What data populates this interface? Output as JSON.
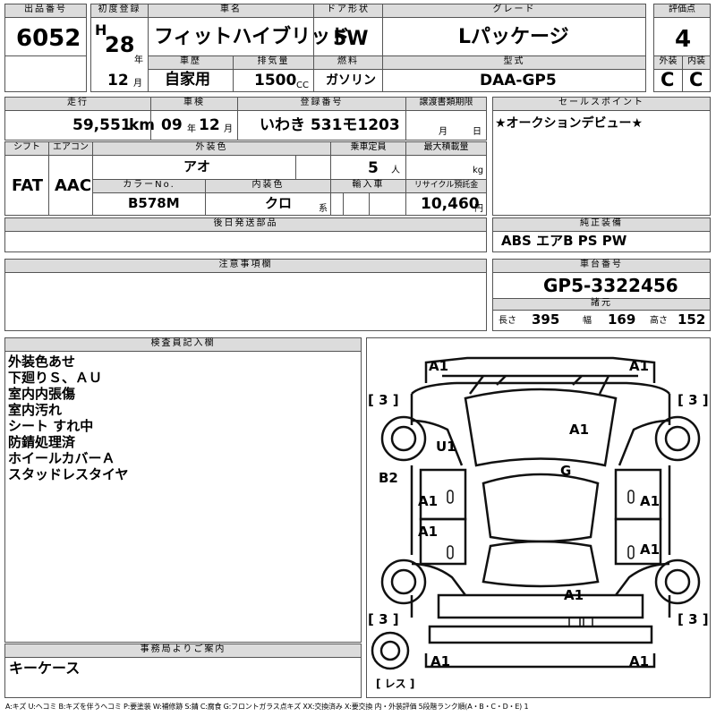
{
  "header": {
    "lot_label": "出品番号",
    "lot": "6052",
    "first_reg_label": "初度登録",
    "era": "H",
    "year": "28",
    "year_unit": "年",
    "month": "12",
    "month_unit": "月",
    "car_name_label": "車名",
    "car_name": "フィットハイブリッド",
    "history_label": "車歴",
    "history": "自家用",
    "displacement_label": "排気量",
    "displacement": "1500",
    "displacement_unit": "CC",
    "door_label": "ドア形状",
    "door": "5W",
    "fuel_label": "燃料",
    "fuel": "ガソリン",
    "grade_label": "グレード",
    "grade": "Lパッケージ",
    "model_label": "型式",
    "model": "DAA-GP5",
    "score_label": "評価点",
    "score": "4",
    "exterior_label": "外装",
    "exterior": "C",
    "interior_label": "内装",
    "interior": "C"
  },
  "row2": {
    "mileage_label": "走行",
    "mileage": "59,551",
    "mileage_unit": "km",
    "inspection_label": "車検",
    "insp_year": "09",
    "insp_year_unit": "年",
    "insp_month": "12",
    "insp_month_unit": "月",
    "reg_label": "登録番号",
    "reg": "いわき 531モ1203",
    "transfer_label": "譲渡書類期限",
    "transfer_month_unit": "月",
    "transfer_day_unit": "日",
    "shift_label": "シフト",
    "shift": "FAT",
    "ac_label": "エアコン",
    "ac": "AAC",
    "color_label": "外装色",
    "color": "アオ",
    "capacity_label": "乗車定員",
    "capacity": "5",
    "capacity_unit": "人",
    "load_label": "最大積載量",
    "load_unit": "kg",
    "color_no_label": "カラーNo.",
    "color_no": "B578M",
    "int_color_label": "内装色",
    "int_color": "クロ",
    "int_color_unit": "系",
    "import_label": "輸入車",
    "recycle_label": "リサイクル預託金",
    "recycle": "10,460",
    "recycle_unit": "円",
    "selling_label": "セールスポイント",
    "selling": "★オークションデビュー★"
  },
  "parts": {
    "label": "後日発送部品",
    "equip_label": "純正装備",
    "equip": "ABS エアB PS PW"
  },
  "notes": {
    "label": "注意事項欄"
  },
  "chassis": {
    "label": "車台番号",
    "number": "GP5-3322456",
    "spec_label": "諸元",
    "length_label": "長さ",
    "length": "395",
    "width_label": "幅",
    "width": "169",
    "height_label": "高さ",
    "height": "152"
  },
  "inspector": {
    "label": "検査員記入欄",
    "lines": [
      "外装色あせ",
      "下廻りＳ、ＡＵ",
      "室内内張傷",
      "室内汚れ",
      "シート すれ中",
      "防錆処理済",
      "ホイールカバーＡ",
      "スタッドレスタイヤ"
    ]
  },
  "office": {
    "label": "事務局よりご案内",
    "text": "キーケース"
  },
  "damage": {
    "a1_fl": "A1",
    "a1_fr": "A1",
    "tread_fl": "[ 3 ]",
    "tread_fr": "[ 3 ]",
    "u1": "U1",
    "hood": "A1",
    "roof": "G",
    "b2": "B2",
    "a1_ld": "A1",
    "a1_rd": "A1",
    "a1_lr": "A1",
    "a1_rr": "A1",
    "trunk": "A1",
    "tread_rl": "[ 3 ]",
    "tread_rr": "[ 3 ]",
    "a1_bl": "A1",
    "a1_br": "A1",
    "spare": "[ レス ]"
  },
  "legend": "A:キズ U:ヘコミ B:キズを伴うヘコミ P:要塗装 W:補修跡 S:錆 C:腐食 G:フロントガラス点キズ XX:交換済み X:要交換 内・外装評価 5段階ランク順(A・B・C・D・E) 1"
}
